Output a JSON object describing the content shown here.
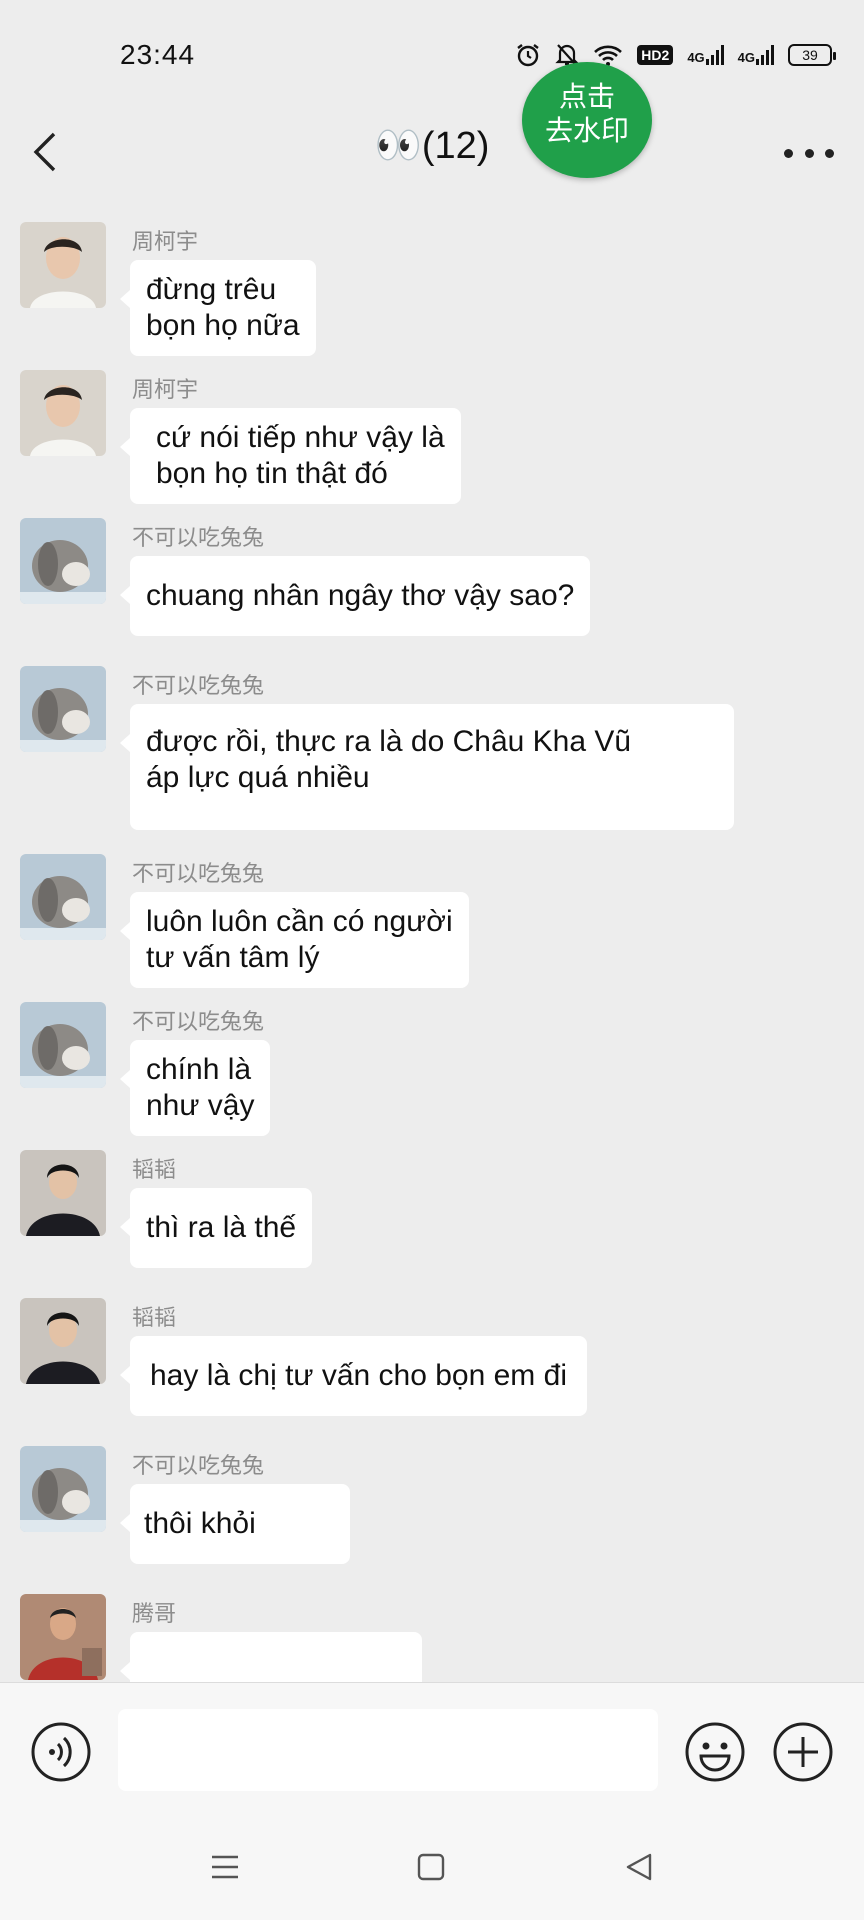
{
  "status_bar": {
    "time": "23:44",
    "hd_badge": "HD2",
    "network_1": "4G",
    "network_2": "4G",
    "battery": "39"
  },
  "header": {
    "title": "👀(12)",
    "watermark_line1": "点击",
    "watermark_line2": "去水印"
  },
  "messages": [
    {
      "sender": "周柯宇",
      "text": "đừng trêu\nbọn họ nữa",
      "avatar": "person-white-shirt"
    },
    {
      "sender": "周柯宇",
      "text": "cứ nói tiếp như vậy là\nbọn họ tin thật đó",
      "avatar": "person-white-shirt"
    },
    {
      "sender": "不可以吃兔兔",
      "text": "chuang nhân ngây thơ vậy sao?",
      "avatar": "rabbit"
    },
    {
      "sender": "不可以吃兔兔",
      "text": "được rồi, thực ra là do Châu Kha Vũ\náp lực quá nhiều",
      "avatar": "rabbit"
    },
    {
      "sender": "不可以吃兔兔",
      "text": "luôn luôn cần có người\ntư vấn tâm lý",
      "avatar": "rabbit"
    },
    {
      "sender": "不可以吃兔兔",
      "text": "chính là\nnhư vậy",
      "avatar": "rabbit"
    },
    {
      "sender": "韬韬",
      "text": "thì ra là thế",
      "avatar": "person-dark-jacket"
    },
    {
      "sender": "韬韬",
      "text": "hay là chị tư vấn cho bọn em đi",
      "avatar": "person-dark-jacket"
    },
    {
      "sender": "不可以吃兔兔",
      "text": "thôi khỏi",
      "avatar": "rabbit"
    },
    {
      "sender": "腾哥",
      "text": "",
      "avatar": "person-red-shirt"
    }
  ],
  "input_bar": {
    "placeholder": ""
  },
  "icons": {
    "back": "chevron-left-icon",
    "more": "more-dots-icon",
    "voice": "voice-icon",
    "emoji": "emoji-icon",
    "plus": "plus-circle-icon",
    "nav_menu": "menu-icon",
    "nav_home": "home-square-icon",
    "nav_back": "triangle-back-icon"
  },
  "colors": {
    "background": "#ededed",
    "bubble": "#ffffff",
    "watermark_green": "#20a04a",
    "sender_gray": "#8c8c8c"
  }
}
